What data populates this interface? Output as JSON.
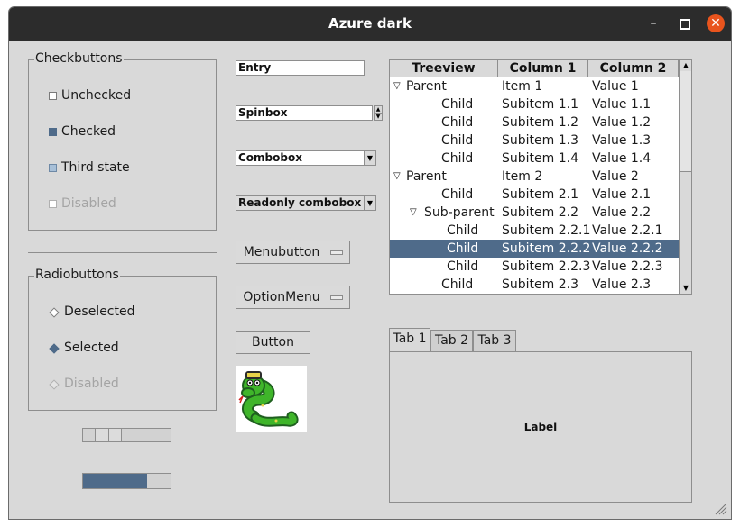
{
  "window": {
    "title": "Azure dark",
    "minimize": "–",
    "maximize": "□",
    "close": "✕"
  },
  "checkbuttons": {
    "label": "Checkbuttons",
    "items": [
      {
        "label": "Unchecked",
        "state": "unchecked",
        "disabled": false
      },
      {
        "label": "Checked",
        "state": "checked",
        "disabled": false
      },
      {
        "label": "Third state",
        "state": "indeterminate",
        "disabled": false
      },
      {
        "label": "Disabled",
        "state": "unchecked",
        "disabled": true
      }
    ]
  },
  "radiobuttons": {
    "label": "Radiobuttons",
    "items": [
      {
        "label": "Deselected",
        "selected": false,
        "disabled": false
      },
      {
        "label": "Selected",
        "selected": true,
        "disabled": false
      },
      {
        "label": "Disabled",
        "selected": false,
        "disabled": true
      }
    ]
  },
  "scale": {
    "value": 0.2
  },
  "progressbar": {
    "value": 0.73
  },
  "widgets": {
    "entry_value": "Entry",
    "spinbox_value": "Spinbox",
    "combobox_value": "Combobox",
    "readonly_combobox_value": "Readonly combobox",
    "menubutton_label": "Menubutton",
    "optionmenu_label": "OptionMenu",
    "button_label": "Button"
  },
  "treeview": {
    "columns": [
      "Treeview",
      "Column 1",
      "Column 2"
    ],
    "rows": [
      {
        "name": "Parent",
        "col1": "Item 1",
        "col2": "Value 1",
        "level": 0,
        "expander": "▽",
        "selected": false
      },
      {
        "name": "Child",
        "col1": "Subitem 1.1",
        "col2": "Value 1.1",
        "level": 1,
        "expander": "",
        "selected": false
      },
      {
        "name": "Child",
        "col1": "Subitem 1.2",
        "col2": "Value 1.2",
        "level": 1,
        "expander": "",
        "selected": false
      },
      {
        "name": "Child",
        "col1": "Subitem 1.3",
        "col2": "Value 1.3",
        "level": 1,
        "expander": "",
        "selected": false
      },
      {
        "name": "Child",
        "col1": "Subitem 1.4",
        "col2": "Value 1.4",
        "level": 1,
        "expander": "",
        "selected": false
      },
      {
        "name": "Parent",
        "col1": "Item 2",
        "col2": "Value 2",
        "level": 0,
        "expander": "▽",
        "selected": false
      },
      {
        "name": "Child",
        "col1": "Subitem 2.1",
        "col2": "Value 2.1",
        "level": 1,
        "expander": "",
        "selected": false
      },
      {
        "name": "Sub-parent",
        "col1": "Subitem 2.2",
        "col2": "Value 2.2",
        "level": 1,
        "expander": "▽",
        "selected": false
      },
      {
        "name": "Child",
        "col1": "Subitem 2.2.1",
        "col2": "Value 2.2.1",
        "level": 2,
        "expander": "",
        "selected": false
      },
      {
        "name": "Child",
        "col1": "Subitem 2.2.2",
        "col2": "Value 2.2.2",
        "level": 2,
        "expander": "",
        "selected": true
      },
      {
        "name": "Child",
        "col1": "Subitem 2.2.3",
        "col2": "Value 2.2.3",
        "level": 2,
        "expander": "",
        "selected": false
      },
      {
        "name": "Child",
        "col1": "Subitem 2.3",
        "col2": "Value 2.3",
        "level": 1,
        "expander": "",
        "selected": false
      }
    ]
  },
  "notebook": {
    "tabs": [
      "Tab 1",
      "Tab 2",
      "Tab 3"
    ],
    "active_tab": 0,
    "label": "Label"
  },
  "colors": {
    "titlebar": "#2c2c2c",
    "window_bg": "#d9d9d9",
    "accent": "#4f6b8a",
    "close_button": "#e9541d"
  },
  "icons": {
    "scrollbar_up": "▲",
    "scrollbar_down": "▼",
    "spin_up": "▲",
    "spin_down": "▼",
    "combo_down": "▼"
  }
}
